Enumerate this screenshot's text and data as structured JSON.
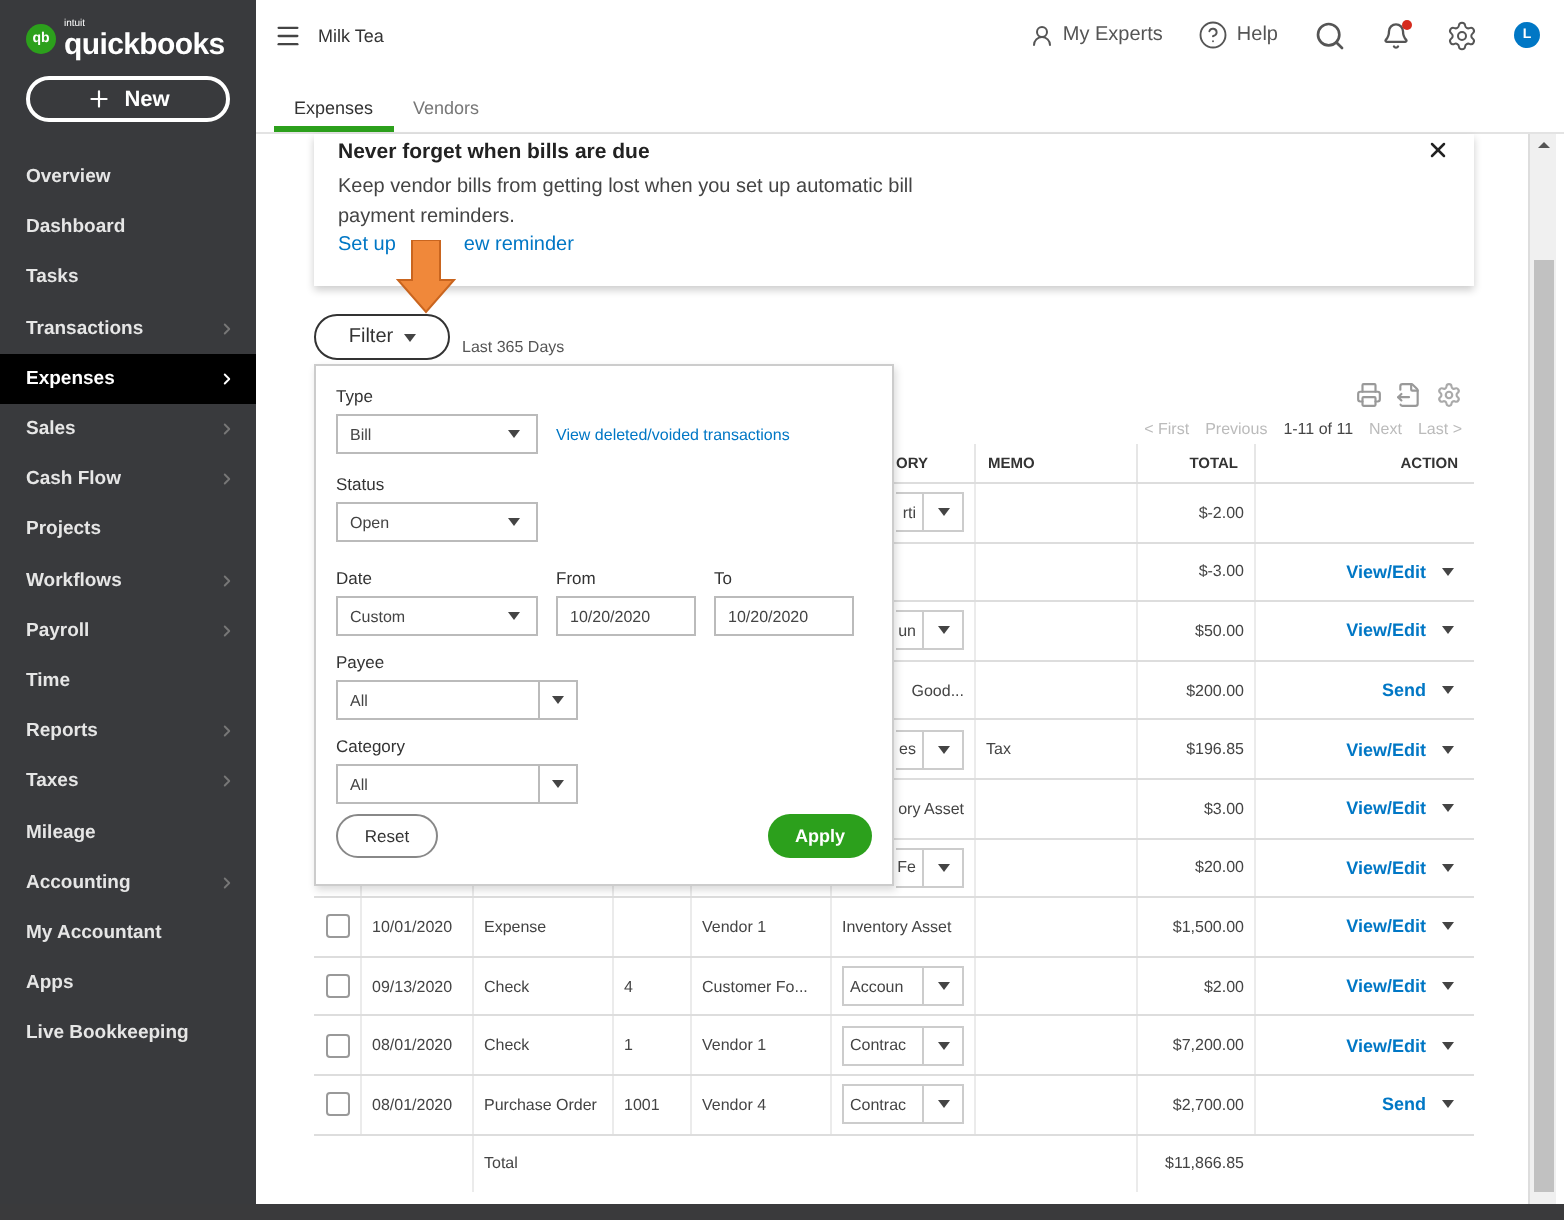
{
  "sidebar": {
    "logo": {
      "badge": "qb",
      "maker": "intuit",
      "name": "quickbooks"
    },
    "new_button": "New",
    "items": [
      {
        "label": "Overview",
        "submenu": false,
        "selected": false
      },
      {
        "label": "Dashboard",
        "submenu": false,
        "selected": false
      },
      {
        "label": "Tasks",
        "submenu": false,
        "selected": false
      },
      {
        "label": "Transactions",
        "submenu": true,
        "selected": false
      },
      {
        "label": "Expenses",
        "submenu": true,
        "selected": true
      },
      {
        "label": "Sales",
        "submenu": true,
        "selected": false
      },
      {
        "label": "Cash Flow",
        "submenu": true,
        "selected": false
      },
      {
        "label": "Projects",
        "submenu": false,
        "selected": false
      },
      {
        "label": "Workflows",
        "submenu": true,
        "selected": false
      },
      {
        "label": "Payroll",
        "submenu": true,
        "selected": false
      },
      {
        "label": "Time",
        "submenu": false,
        "selected": false
      },
      {
        "label": "Reports",
        "submenu": true,
        "selected": false
      },
      {
        "label": "Taxes",
        "submenu": true,
        "selected": false
      },
      {
        "label": "Mileage",
        "submenu": false,
        "selected": false
      },
      {
        "label": "Accounting",
        "submenu": true,
        "selected": false
      },
      {
        "label": "My Accountant",
        "submenu": false,
        "selected": false
      },
      {
        "label": "Apps",
        "submenu": false,
        "selected": false
      },
      {
        "label": "Live Bookkeeping",
        "submenu": false,
        "selected": false
      }
    ]
  },
  "topbar": {
    "company": "Milk Tea",
    "experts": "My Experts",
    "help": "Help",
    "avatar": "L",
    "notification": true
  },
  "tabs": [
    {
      "label": "Expenses",
      "selected": true
    },
    {
      "label": "Vendors",
      "selected": false
    }
  ],
  "banner": {
    "title": "Never forget when bills are due",
    "text": "Keep vendor bills from getting lost when you set up automatic bill payment reminders.",
    "link_parts": [
      "Set up",
      "ew reminder"
    ]
  },
  "filter": {
    "button": "Filter",
    "range": "Last 365 Days"
  },
  "filter_panel": {
    "type_label": "Type",
    "type_value": "Bill",
    "deleted_link": "View deleted/voided transactions",
    "status_label": "Status",
    "status_value": "Open",
    "date_label": "Date",
    "date_value": "Custom",
    "from_label": "From",
    "from_value": "10/20/2020",
    "to_label": "To",
    "to_value": "10/20/2020",
    "payee_label": "Payee",
    "payee_value": "All",
    "category_label": "Category",
    "category_value": "All",
    "reset": "Reset",
    "apply": "Apply"
  },
  "pager": {
    "before": [
      {
        "label": "< First",
        "disabled": true
      },
      {
        "label": "Previous",
        "disabled": true
      }
    ],
    "range": "1-11 of 11",
    "after": [
      {
        "label": "Next",
        "disabled": true
      },
      {
        "label": "Last >",
        "disabled": true
      }
    ]
  },
  "table": {
    "columns": [
      "ORY",
      "MEMO",
      "TOTAL",
      "ACTION"
    ],
    "rows": [
      {
        "category": {
          "kind": "select",
          "text": "rti",
          "cut": true
        },
        "total": "$-2.00"
      },
      {
        "total": "$-3.00",
        "action": "View/Edit"
      },
      {
        "category": {
          "kind": "select",
          "text": "un",
          "cut": true
        },
        "total": "$50.00",
        "action": "View/Edit"
      },
      {
        "category": {
          "kind": "text",
          "text": "Good...",
          "cut": true
        },
        "total": "$200.00",
        "action": "Send"
      },
      {
        "category": {
          "kind": "select",
          "text": "es",
          "cut": true
        },
        "memo": "Tax",
        "total": "$196.85",
        "action": "View/Edit"
      },
      {
        "category": {
          "kind": "text",
          "text": "ory Asset",
          "cut": true
        },
        "total": "$3.00",
        "action": "View/Edit"
      },
      {
        "category": {
          "kind": "select",
          "text": "Fe",
          "cut": true
        },
        "total": "$20.00",
        "action": "View/Edit"
      },
      {
        "checked": false,
        "date": "10/01/2020",
        "type": "Expense",
        "payee": "Vendor 1",
        "category": {
          "kind": "text",
          "text": "Inventory Asset",
          "cut": false
        },
        "total": "$1,500.00",
        "action": "View/Edit"
      },
      {
        "checked": false,
        "date": "09/13/2020",
        "type": "Check",
        "no": "4",
        "payee": "Customer Fo...",
        "category": {
          "kind": "select",
          "text": "Accoun",
          "cut": false
        },
        "total": "$2.00",
        "action": "View/Edit"
      },
      {
        "checked": false,
        "date": "08/01/2020",
        "type": "Check",
        "no": "1",
        "payee": "Vendor 1",
        "category": {
          "kind": "select",
          "text": "Contrac",
          "cut": false
        },
        "total": "$7,200.00",
        "action": "View/Edit"
      },
      {
        "checked": false,
        "date": "08/01/2020",
        "type": "Purchase Order",
        "no": "1001",
        "payee": "Vendor 4",
        "category": {
          "kind": "select",
          "text": "Contrac",
          "cut": false
        },
        "total": "$2,700.00",
        "action": "Send"
      }
    ],
    "total_label": "Total",
    "total": "$11,866.85"
  }
}
